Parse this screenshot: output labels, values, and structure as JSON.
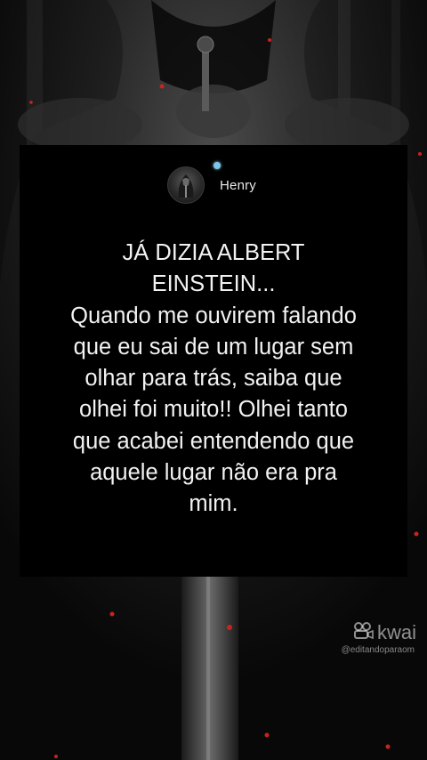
{
  "author": {
    "name": "Henry",
    "avatar_icon": "knight-avatar-icon",
    "badge_color": "#7cc6e8"
  },
  "quote": {
    "lines": [
      "JÁ DIZIA ALBERT",
      "EINSTEIN...",
      "Quando me ouvirem falando",
      "que eu sai de um lugar sem",
      "olhar para trás, saiba que",
      "olhei foi muito!! Olhei tanto",
      "que acabei entendendo que",
      "aquele lugar não era pra",
      "mim."
    ]
  },
  "watermark": {
    "brand": "kwai",
    "handle": "@editandoparaom",
    "icon": "kwai-logo-icon"
  },
  "colors": {
    "card_background": "#000000",
    "text": "#f2f2f2",
    "embers": "#c8241e"
  }
}
